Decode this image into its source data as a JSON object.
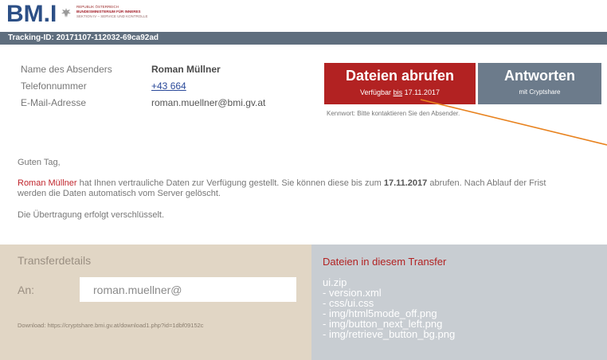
{
  "header": {
    "logo_text": "BM.I",
    "ministry_line1": "REPUBLIK ÖSTERREICH",
    "ministry_line2": "BUNDESMINISTERIUM FÜR INNERES",
    "ministry_line3": "SEKTION IV – SERVICE UND KONTROLLE"
  },
  "tracking": {
    "text": "Tracking-ID: 20171107-112032-69ca92ad"
  },
  "sender": {
    "name_label": "Name des Absenders",
    "name_value": "Roman Müllner",
    "phone_label": "Telefonnummer",
    "phone_value": "+43 664",
    "email_label": "E-Mail-Adresse",
    "email_value": "roman.muellner@bmi.gv.at"
  },
  "actions": {
    "retrieve_label": "Dateien abrufen",
    "retrieve_sub_prefix": "Verfügbar ",
    "retrieve_sub_link": "bis",
    "retrieve_sub_suffix": " 17.11.2017",
    "answer_label": "Antworten",
    "answer_sub": "mit Cryptshare",
    "password_note": "Kennwort: Bitte kontaktieren Sie den Absender."
  },
  "message": {
    "greeting": "Guten Tag,",
    "sender_name": "Roman Müllner",
    "body_part1": " hat Ihnen vertrauliche Daten zur Verfügung gestellt. Sie können diese bis zum ",
    "body_date": "17.11.2017",
    "body_part2": " abrufen. Nach Ablauf der Frist",
    "body_line2": "werden die Daten automatisch vom Server gelöscht.",
    "encryption": "Die Übertragung erfolgt verschlüsselt."
  },
  "transfer": {
    "title": "Transferdetails",
    "to_label": "An:",
    "to_value": "roman.muellner@",
    "download": "Download: https://cryptshare.bmi.gv.at/download1.php?id=1dbf09152c"
  },
  "files": {
    "title": "Dateien in diesem Transfer",
    "items": [
      "ui.zip",
      "- version.xml",
      "- css/ui.css",
      "- img/html5mode_off.png",
      "- img/button_next_left.png",
      "- img/retrieve_button_bg.png"
    ]
  },
  "colors": {
    "brand_blue": "#2c4f86",
    "brand_red": "#b22222",
    "tracking_bar": "#5f6e7e",
    "answer_button": "#6c7b8b",
    "panel_left": "#e1d6c5",
    "panel_right": "#c8cdd2",
    "arrow": "#e8821e"
  }
}
